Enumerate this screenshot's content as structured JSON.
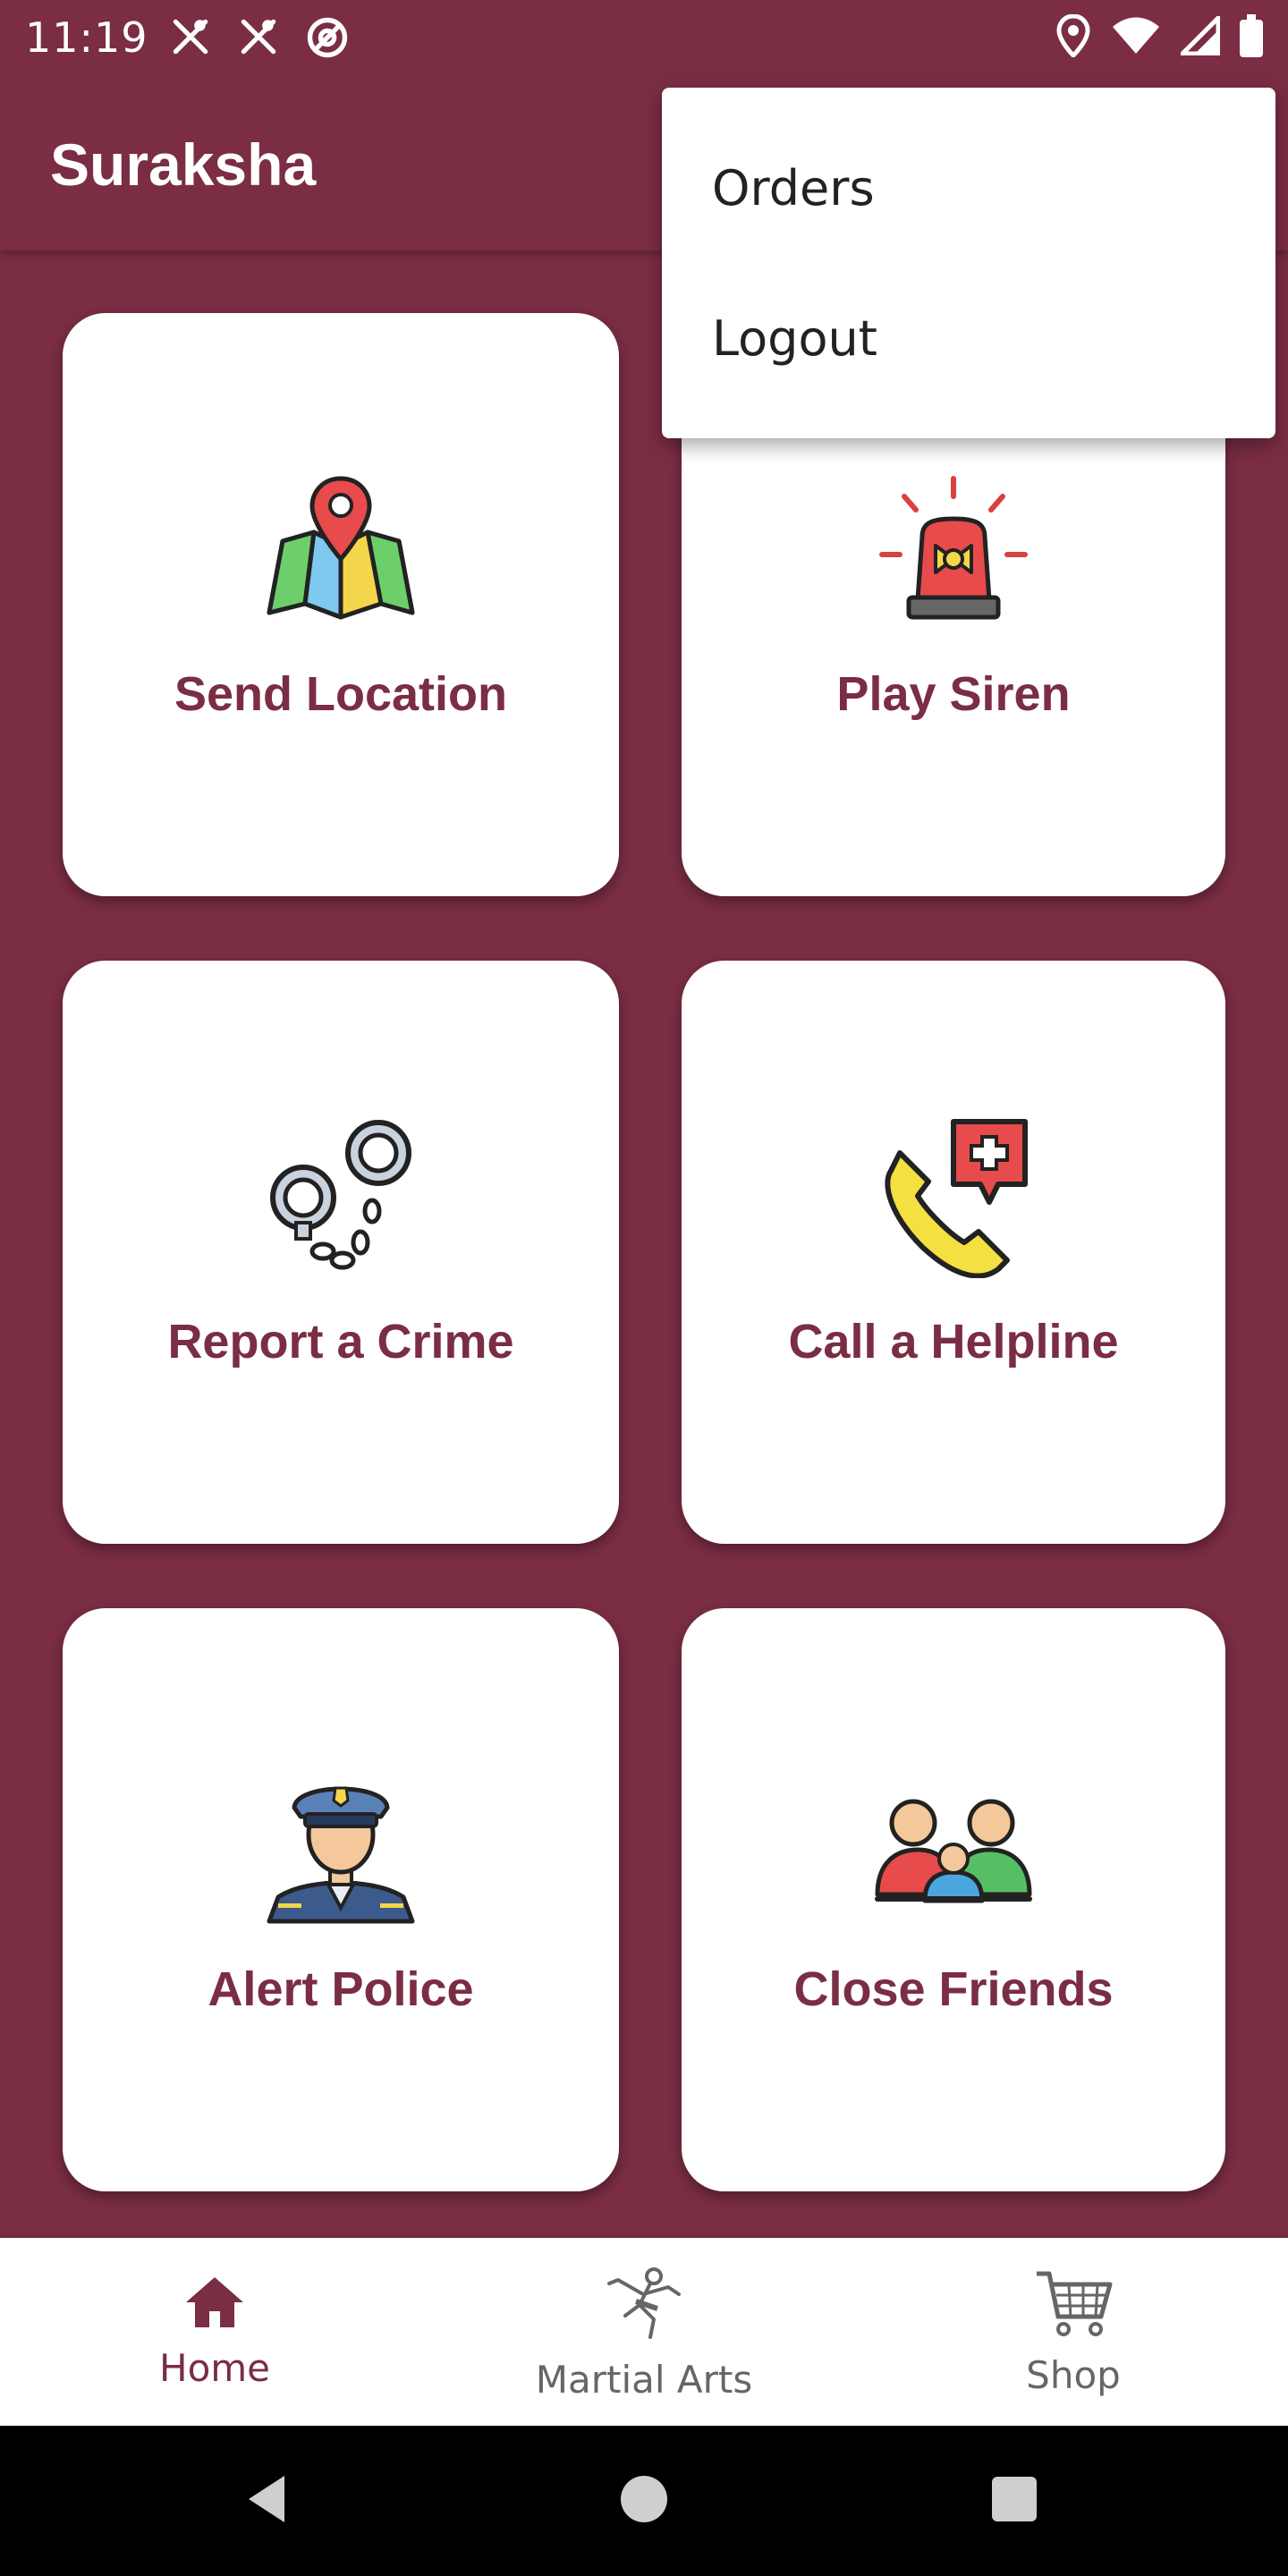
{
  "status_bar": {
    "time": "11:19",
    "left_icons": [
      "tools-icon",
      "tools-icon",
      "at-sync-icon"
    ],
    "right_icons": [
      "location-pin-icon",
      "wifi-icon",
      "cell-signal-icon",
      "battery-icon"
    ]
  },
  "app_bar": {
    "title": "Suraksha"
  },
  "overflow_menu": {
    "items": [
      {
        "label": "Orders"
      },
      {
        "label": "Logout"
      }
    ]
  },
  "cards": [
    {
      "label": "Send Location",
      "icon": "map-pin-icon"
    },
    {
      "label": "Play Siren",
      "icon": "siren-icon"
    },
    {
      "label": "Report a Crime",
      "icon": "handcuffs-icon"
    },
    {
      "label": "Call a Helpline",
      "icon": "phone-medical-icon"
    },
    {
      "label": "Alert Police",
      "icon": "police-officer-icon"
    },
    {
      "label": "Close Friends",
      "icon": "group-people-icon"
    }
  ],
  "bottom_nav": {
    "items": [
      {
        "label": "Home",
        "icon": "home-icon",
        "active": true
      },
      {
        "label": "Martial Arts",
        "icon": "martial-arts-icon",
        "active": false
      },
      {
        "label": "Shop",
        "icon": "shopping-cart-icon",
        "active": false
      }
    ]
  },
  "colors": {
    "primary": "#7a2d43",
    "surface": "#ffffff",
    "nav_inactive": "#666666"
  }
}
